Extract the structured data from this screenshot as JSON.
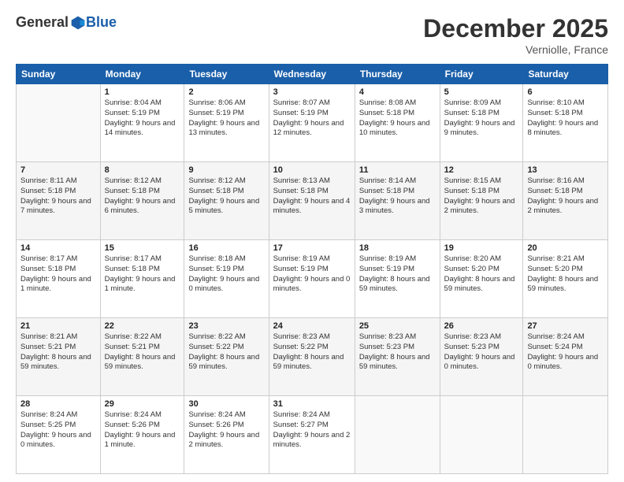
{
  "header": {
    "logo_general": "General",
    "logo_blue": "Blue",
    "month_title": "December 2025",
    "location": "Verniolle, France"
  },
  "days_of_week": [
    "Sunday",
    "Monday",
    "Tuesday",
    "Wednesday",
    "Thursday",
    "Friday",
    "Saturday"
  ],
  "weeks": [
    [
      {
        "day": "",
        "sunrise": "",
        "sunset": "",
        "daylight": "",
        "empty": true
      },
      {
        "day": "1",
        "sunrise": "Sunrise: 8:04 AM",
        "sunset": "Sunset: 5:19 PM",
        "daylight": "Daylight: 9 hours and 14 minutes."
      },
      {
        "day": "2",
        "sunrise": "Sunrise: 8:06 AM",
        "sunset": "Sunset: 5:19 PM",
        "daylight": "Daylight: 9 hours and 13 minutes."
      },
      {
        "day": "3",
        "sunrise": "Sunrise: 8:07 AM",
        "sunset": "Sunset: 5:19 PM",
        "daylight": "Daylight: 9 hours and 12 minutes."
      },
      {
        "day": "4",
        "sunrise": "Sunrise: 8:08 AM",
        "sunset": "Sunset: 5:18 PM",
        "daylight": "Daylight: 9 hours and 10 minutes."
      },
      {
        "day": "5",
        "sunrise": "Sunrise: 8:09 AM",
        "sunset": "Sunset: 5:18 PM",
        "daylight": "Daylight: 9 hours and 9 minutes."
      },
      {
        "day": "6",
        "sunrise": "Sunrise: 8:10 AM",
        "sunset": "Sunset: 5:18 PM",
        "daylight": "Daylight: 9 hours and 8 minutes."
      }
    ],
    [
      {
        "day": "7",
        "sunrise": "Sunrise: 8:11 AM",
        "sunset": "Sunset: 5:18 PM",
        "daylight": "Daylight: 9 hours and 7 minutes."
      },
      {
        "day": "8",
        "sunrise": "Sunrise: 8:12 AM",
        "sunset": "Sunset: 5:18 PM",
        "daylight": "Daylight: 9 hours and 6 minutes."
      },
      {
        "day": "9",
        "sunrise": "Sunrise: 8:12 AM",
        "sunset": "Sunset: 5:18 PM",
        "daylight": "Daylight: 9 hours and 5 minutes."
      },
      {
        "day": "10",
        "sunrise": "Sunrise: 8:13 AM",
        "sunset": "Sunset: 5:18 PM",
        "daylight": "Daylight: 9 hours and 4 minutes."
      },
      {
        "day": "11",
        "sunrise": "Sunrise: 8:14 AM",
        "sunset": "Sunset: 5:18 PM",
        "daylight": "Daylight: 9 hours and 3 minutes."
      },
      {
        "day": "12",
        "sunrise": "Sunrise: 8:15 AM",
        "sunset": "Sunset: 5:18 PM",
        "daylight": "Daylight: 9 hours and 2 minutes."
      },
      {
        "day": "13",
        "sunrise": "Sunrise: 8:16 AM",
        "sunset": "Sunset: 5:18 PM",
        "daylight": "Daylight: 9 hours and 2 minutes."
      }
    ],
    [
      {
        "day": "14",
        "sunrise": "Sunrise: 8:17 AM",
        "sunset": "Sunset: 5:18 PM",
        "daylight": "Daylight: 9 hours and 1 minute."
      },
      {
        "day": "15",
        "sunrise": "Sunrise: 8:17 AM",
        "sunset": "Sunset: 5:18 PM",
        "daylight": "Daylight: 9 hours and 1 minute."
      },
      {
        "day": "16",
        "sunrise": "Sunrise: 8:18 AM",
        "sunset": "Sunset: 5:19 PM",
        "daylight": "Daylight: 9 hours and 0 minutes."
      },
      {
        "day": "17",
        "sunrise": "Sunrise: 8:19 AM",
        "sunset": "Sunset: 5:19 PM",
        "daylight": "Daylight: 9 hours and 0 minutes."
      },
      {
        "day": "18",
        "sunrise": "Sunrise: 8:19 AM",
        "sunset": "Sunset: 5:19 PM",
        "daylight": "Daylight: 8 hours and 59 minutes."
      },
      {
        "day": "19",
        "sunrise": "Sunrise: 8:20 AM",
        "sunset": "Sunset: 5:20 PM",
        "daylight": "Daylight: 8 hours and 59 minutes."
      },
      {
        "day": "20",
        "sunrise": "Sunrise: 8:21 AM",
        "sunset": "Sunset: 5:20 PM",
        "daylight": "Daylight: 8 hours and 59 minutes."
      }
    ],
    [
      {
        "day": "21",
        "sunrise": "Sunrise: 8:21 AM",
        "sunset": "Sunset: 5:21 PM",
        "daylight": "Daylight: 8 hours and 59 minutes."
      },
      {
        "day": "22",
        "sunrise": "Sunrise: 8:22 AM",
        "sunset": "Sunset: 5:21 PM",
        "daylight": "Daylight: 8 hours and 59 minutes."
      },
      {
        "day": "23",
        "sunrise": "Sunrise: 8:22 AM",
        "sunset": "Sunset: 5:22 PM",
        "daylight": "Daylight: 8 hours and 59 minutes."
      },
      {
        "day": "24",
        "sunrise": "Sunrise: 8:23 AM",
        "sunset": "Sunset: 5:22 PM",
        "daylight": "Daylight: 8 hours and 59 minutes."
      },
      {
        "day": "25",
        "sunrise": "Sunrise: 8:23 AM",
        "sunset": "Sunset: 5:23 PM",
        "daylight": "Daylight: 8 hours and 59 minutes."
      },
      {
        "day": "26",
        "sunrise": "Sunrise: 8:23 AM",
        "sunset": "Sunset: 5:23 PM",
        "daylight": "Daylight: 9 hours and 0 minutes."
      },
      {
        "day": "27",
        "sunrise": "Sunrise: 8:24 AM",
        "sunset": "Sunset: 5:24 PM",
        "daylight": "Daylight: 9 hours and 0 minutes."
      }
    ],
    [
      {
        "day": "28",
        "sunrise": "Sunrise: 8:24 AM",
        "sunset": "Sunset: 5:25 PM",
        "daylight": "Daylight: 9 hours and 0 minutes."
      },
      {
        "day": "29",
        "sunrise": "Sunrise: 8:24 AM",
        "sunset": "Sunset: 5:26 PM",
        "daylight": "Daylight: 9 hours and 1 minute."
      },
      {
        "day": "30",
        "sunrise": "Sunrise: 8:24 AM",
        "sunset": "Sunset: 5:26 PM",
        "daylight": "Daylight: 9 hours and 2 minutes."
      },
      {
        "day": "31",
        "sunrise": "Sunrise: 8:24 AM",
        "sunset": "Sunset: 5:27 PM",
        "daylight": "Daylight: 9 hours and 2 minutes."
      },
      {
        "day": "",
        "sunrise": "",
        "sunset": "",
        "daylight": "",
        "empty": true
      },
      {
        "day": "",
        "sunrise": "",
        "sunset": "",
        "daylight": "",
        "empty": true
      },
      {
        "day": "",
        "sunrise": "",
        "sunset": "",
        "daylight": "",
        "empty": true
      }
    ]
  ]
}
